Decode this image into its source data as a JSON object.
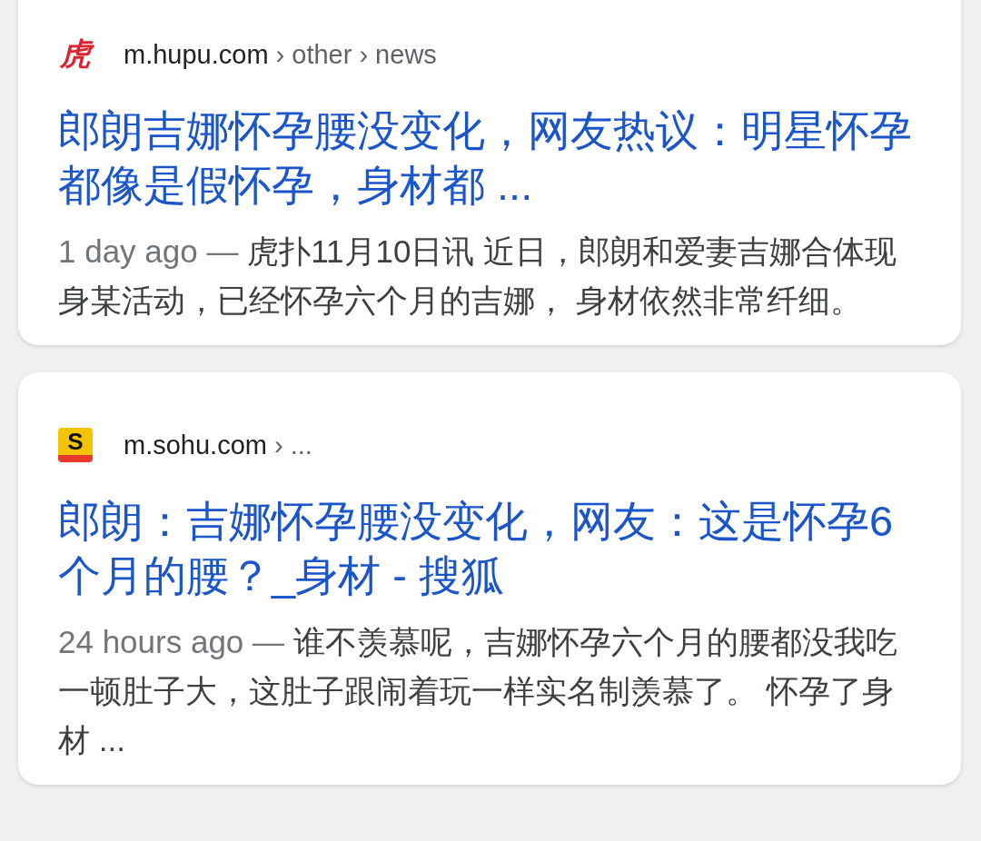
{
  "results": [
    {
      "favicon": {
        "kind": "hupu",
        "text": "虎"
      },
      "domain": "m.hupu.com",
      "breadcrumbs": [
        "› other",
        "› news"
      ],
      "title": "郎朗吉娜怀孕腰没变化，网友热议：明星怀孕都像是假怀孕，身材都 ...",
      "date": "1 day ago —",
      "snippet": "虎扑11月10日讯 近日，郎朗和爱妻吉娜合体现身某活动，已经怀孕六个月的吉娜， 身材依然非常纤细。"
    },
    {
      "favicon": {
        "kind": "sohu",
        "text": "S"
      },
      "domain": "m.sohu.com",
      "breadcrumbs": [
        "› ..."
      ],
      "title": "郎朗：吉娜怀孕腰没变化，网友：这是怀孕6个月的腰？_身材 - 搜狐",
      "date": "24 hours ago —",
      "snippet": "谁不羡慕呢，吉娜怀孕六个月的腰都没我吃一顿肚子大，这肚子跟闹着玩一样实名制羡慕了。 怀孕了身材 ..."
    }
  ]
}
